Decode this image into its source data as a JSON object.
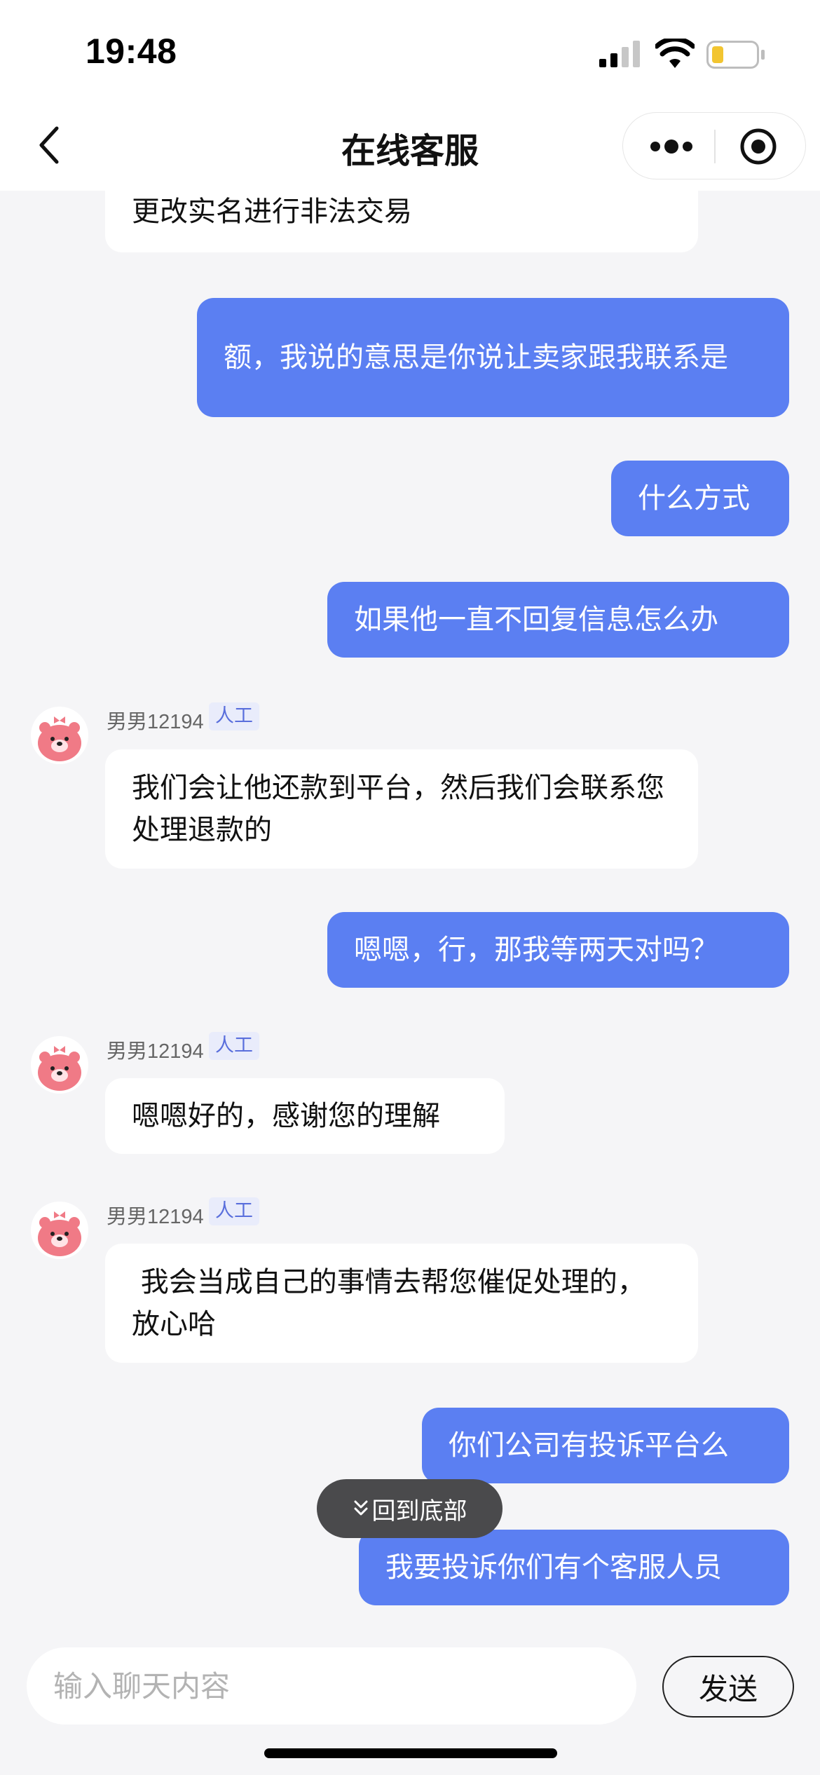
{
  "status_bar": {
    "time": "19:48"
  },
  "nav": {
    "title": "在线客服"
  },
  "agent": {
    "name": "男男12194",
    "tag": "人工"
  },
  "messages": [
    {
      "from": "agent",
      "text": "更改实名进行非法交易"
    },
    {
      "from": "user",
      "text": "额，我说的意思是你说让卖家跟我联系是"
    },
    {
      "from": "user",
      "text": "什么方式"
    },
    {
      "from": "user",
      "text": "如果他一直不回复信息怎么办"
    },
    {
      "from": "agent",
      "text": "我们会让他还款到平台，然后我们会联系您处理退款的"
    },
    {
      "from": "user",
      "text": "嗯嗯，行，那我等两天对吗？"
    },
    {
      "from": "agent",
      "text": "嗯嗯好的，感谢您的理解"
    },
    {
      "from": "agent",
      "text": " 我会当成自己的事情去帮您催促处理的，放心哈"
    },
    {
      "from": "user",
      "text": "你们公司有投诉平台么"
    },
    {
      "from": "user",
      "text": "我要投诉你们有个客服人员"
    }
  ],
  "scroll_to_bottom_label": "回到底部",
  "input": {
    "placeholder": "输入聊天内容",
    "value": ""
  },
  "send_label": "发送",
  "colors": {
    "user_bubble": "#5b7ff2",
    "agent_bubble": "#ffffff",
    "background": "#f5f5f7"
  },
  "icons": [
    "back-chevron-icon",
    "more-dots-icon",
    "close-target-icon",
    "signal-icon",
    "wifi-icon",
    "battery-icon",
    "double-chevron-down-icon"
  ]
}
